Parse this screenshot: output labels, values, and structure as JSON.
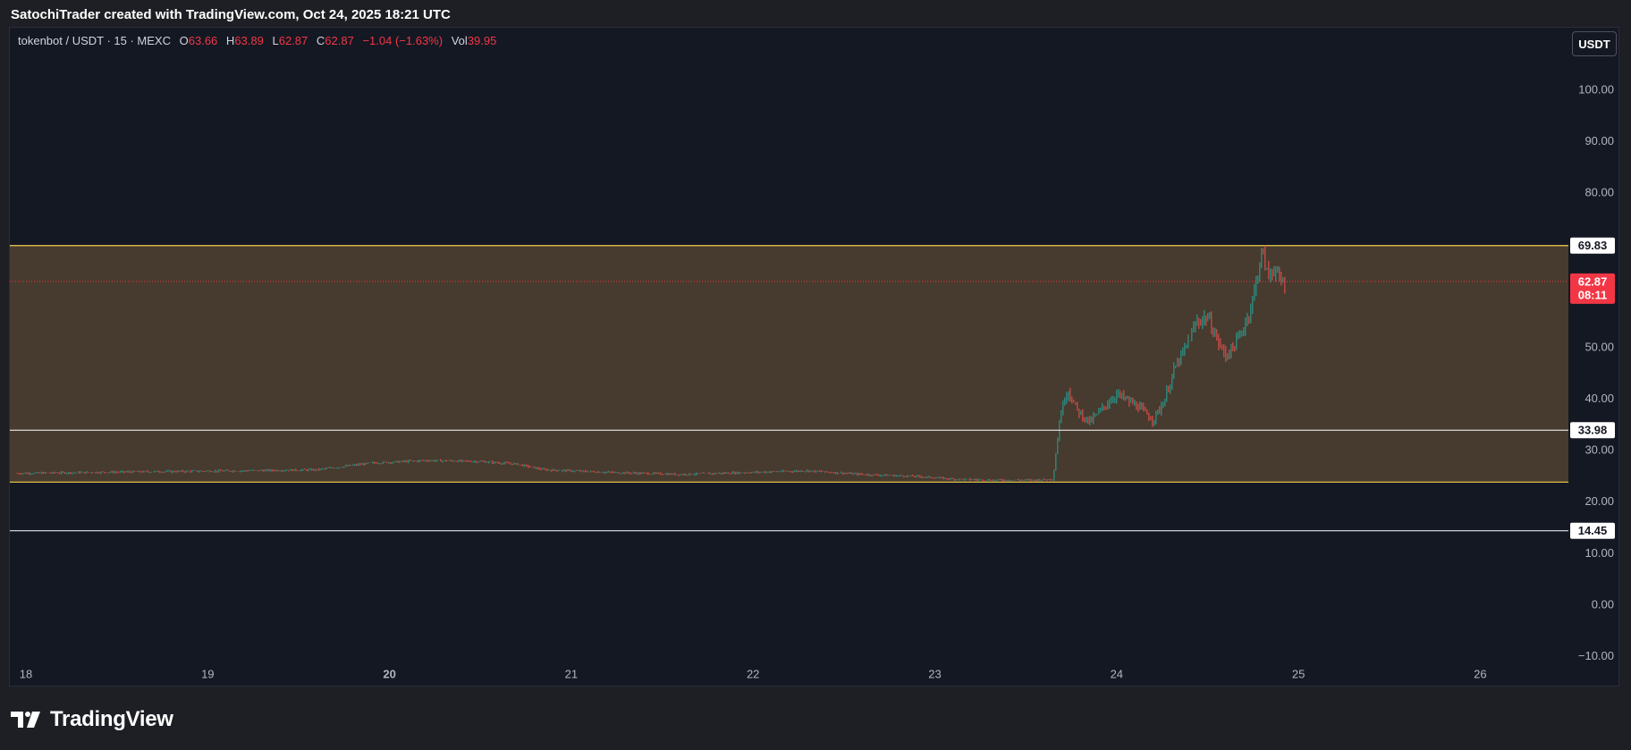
{
  "caption": "SatochiTrader created with TradingView.com, Oct 24, 2025 18:21 UTC",
  "legend": {
    "symbol": "tokenbot / USDT · 15 · MEXC",
    "open_label": "O",
    "open": "63.66",
    "high_label": "H",
    "high": "63.89",
    "low_label": "L",
    "low": "62.87",
    "close_label": "C",
    "close": "62.87",
    "change": "−1.04 (−1.63%)",
    "vol_label": "Vol",
    "vol": "39.95"
  },
  "currency_button": "USDT",
  "brand": {
    "name": "TradingView",
    "icon": "tradingview-logo-icon"
  },
  "colors": {
    "background": "#141823",
    "zone_fill": "#473a2e",
    "zone_border": "#f0d050",
    "up": "#26a69a",
    "down": "#ef5350",
    "last_price": "#f23645",
    "level_line": "#ffffff"
  },
  "chart_data": {
    "type": "candlestick",
    "symbol": "tokenbot / USDT",
    "interval": "15",
    "exchange": "MEXC",
    "x_tick_labels": [
      "18",
      "19",
      "20",
      "21",
      "22",
      "23",
      "24",
      "25",
      "26"
    ],
    "y_tick_labels": [
      "100.00",
      "90.00",
      "80.00",
      "50.00",
      "40.00",
      "30.00",
      "20.00",
      "10.00",
      "0.00",
      "−10.00"
    ],
    "y_ticks": [
      100,
      90,
      80,
      50,
      40,
      30,
      20,
      10,
      0,
      -10
    ],
    "ylim": [
      -13,
      111
    ],
    "xlim": [
      17.95,
      26.5
    ],
    "zone": {
      "top": 69.83,
      "bottom": 23.9
    },
    "horizontal_levels": [
      {
        "value": 69.83,
        "label": "69.83"
      },
      {
        "value": 33.98,
        "label": "33.98"
      },
      {
        "value": 14.45,
        "label": "14.45"
      }
    ],
    "last_price": {
      "value": 62.87,
      "label": "62.87",
      "countdown": "08:11"
    },
    "price_path": [
      [
        17.95,
        25.6
      ],
      [
        18.6,
        25.9
      ],
      [
        19.2,
        26.1
      ],
      [
        19.6,
        26.3
      ],
      [
        19.9,
        27.6
      ],
      [
        20.2,
        28.1
      ],
      [
        20.5,
        27.9
      ],
      [
        20.7,
        27.4
      ],
      [
        20.85,
        26.3
      ],
      [
        21.2,
        25.8
      ],
      [
        21.6,
        25.4
      ],
      [
        22.0,
        25.8
      ],
      [
        22.3,
        26.1
      ],
      [
        22.6,
        25.4
      ],
      [
        22.9,
        25.0
      ],
      [
        23.1,
        24.5
      ],
      [
        23.3,
        24.3
      ],
      [
        23.55,
        24.3
      ],
      [
        23.65,
        24.5
      ],
      [
        23.69,
        37.0
      ],
      [
        23.73,
        42.0
      ],
      [
        23.78,
        38.0
      ],
      [
        23.85,
        35.5
      ],
      [
        23.93,
        38.5
      ],
      [
        24.0,
        41.0
      ],
      [
        24.05,
        40.0
      ],
      [
        24.12,
        38.5
      ],
      [
        24.2,
        36.0
      ],
      [
        24.26,
        39.5
      ],
      [
        24.32,
        46.0
      ],
      [
        24.38,
        50.0
      ],
      [
        24.44,
        55.0
      ],
      [
        24.5,
        56.0
      ],
      [
        24.56,
        51.0
      ],
      [
        24.6,
        48.5
      ],
      [
        24.65,
        50.5
      ],
      [
        24.7,
        54.0
      ],
      [
        24.74,
        58.0
      ],
      [
        24.78,
        65.0
      ],
      [
        24.8,
        69.0
      ],
      [
        24.83,
        64.0
      ],
      [
        24.87,
        65.5
      ],
      [
        24.9,
        62.5
      ],
      [
        24.93,
        62.87
      ]
    ]
  }
}
